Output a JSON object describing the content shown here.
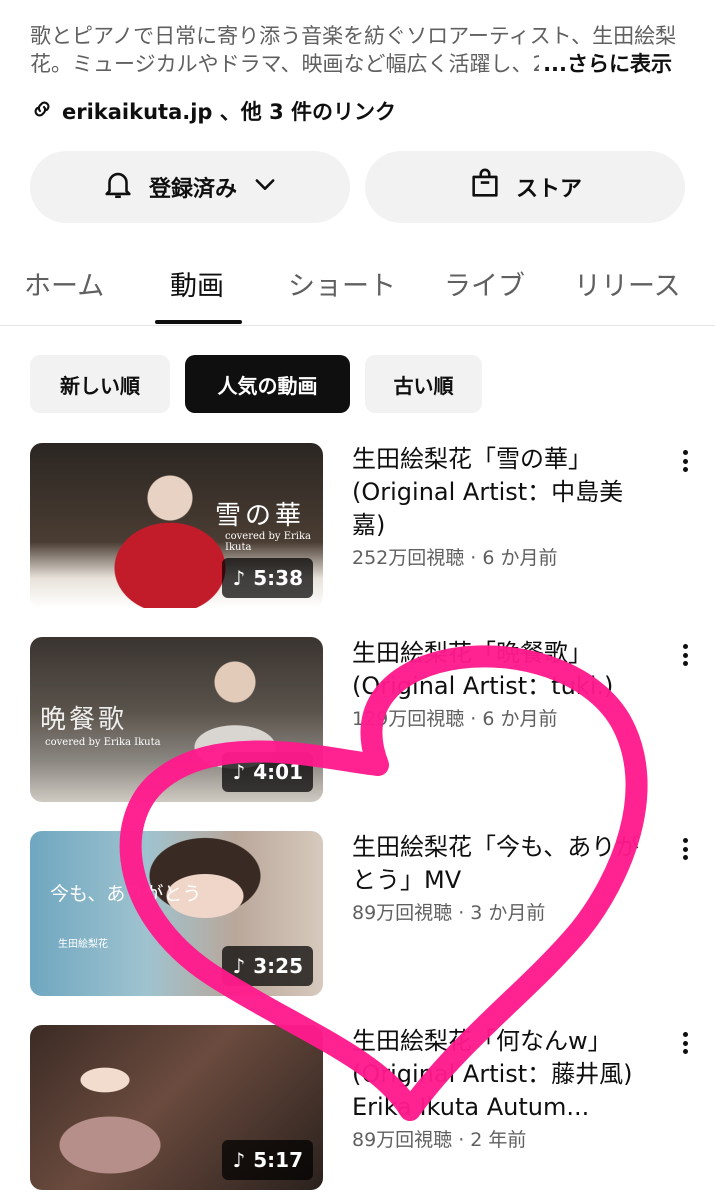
{
  "channel": {
    "description_line1": "歌とピアノで日常に寄り添う音楽を紡ぐソロアーティスト、生田絵梨",
    "description_line2": "花。ミュージカルやドラマ、映画など幅広く活躍し、20",
    "more_label": "...さらに表示",
    "links_text": "erikaikuta.jp 、他 3 件のリンク"
  },
  "actions": {
    "subscribed_label": "登録済み",
    "store_label": "ストア"
  },
  "tabs": [
    {
      "label": "ホーム",
      "active": false
    },
    {
      "label": "動画",
      "active": true
    },
    {
      "label": "ショート",
      "active": false
    },
    {
      "label": "ライブ",
      "active": false
    },
    {
      "label": "リリース",
      "active": false
    }
  ],
  "sort_chips": [
    {
      "label": "新しい順",
      "active": false
    },
    {
      "label": "人気の動画",
      "active": true
    },
    {
      "label": "古い順",
      "active": false
    }
  ],
  "videos": [
    {
      "title": "生田絵梨花「雪の華」(Original Artist：中島美嘉)",
      "meta": "252万回視聴 · 6 か月前",
      "duration": "5:38",
      "thumb_text": "雪の華",
      "thumb_sub": "covered by Erika Ikuta",
      "progress": 0.0
    },
    {
      "title": "生田絵梨花「晩餐歌」(Original Artist：tuki.)",
      "meta": "129万回視聴 · 6 か月前",
      "duration": "4:01",
      "thumb_text": "晩餐歌",
      "thumb_sub": "covered by Erika Ikuta",
      "progress": 0.0
    },
    {
      "title": "生田絵梨花「今も、ありがとう」MV",
      "meta": "89万回視聴 · 3 か月前",
      "duration": "3:25",
      "thumb_text": "今も、ありがとう",
      "thumb_sub": "生田絵梨花",
      "progress": 0.0
    },
    {
      "title": "生田絵梨花「何なんw」(Original Artist：藤井風) Erika Ikuta Autum...",
      "meta": "89万回視聴 · 2 年前",
      "duration": "5:17",
      "progress": 0.0
    }
  ],
  "colors": {
    "accent_red": "#ff0033",
    "heart_pink": "#ff1a8c",
    "text_primary": "#0f0f0f",
    "text_secondary": "#606060",
    "chip_bg": "#f2f2f2"
  }
}
